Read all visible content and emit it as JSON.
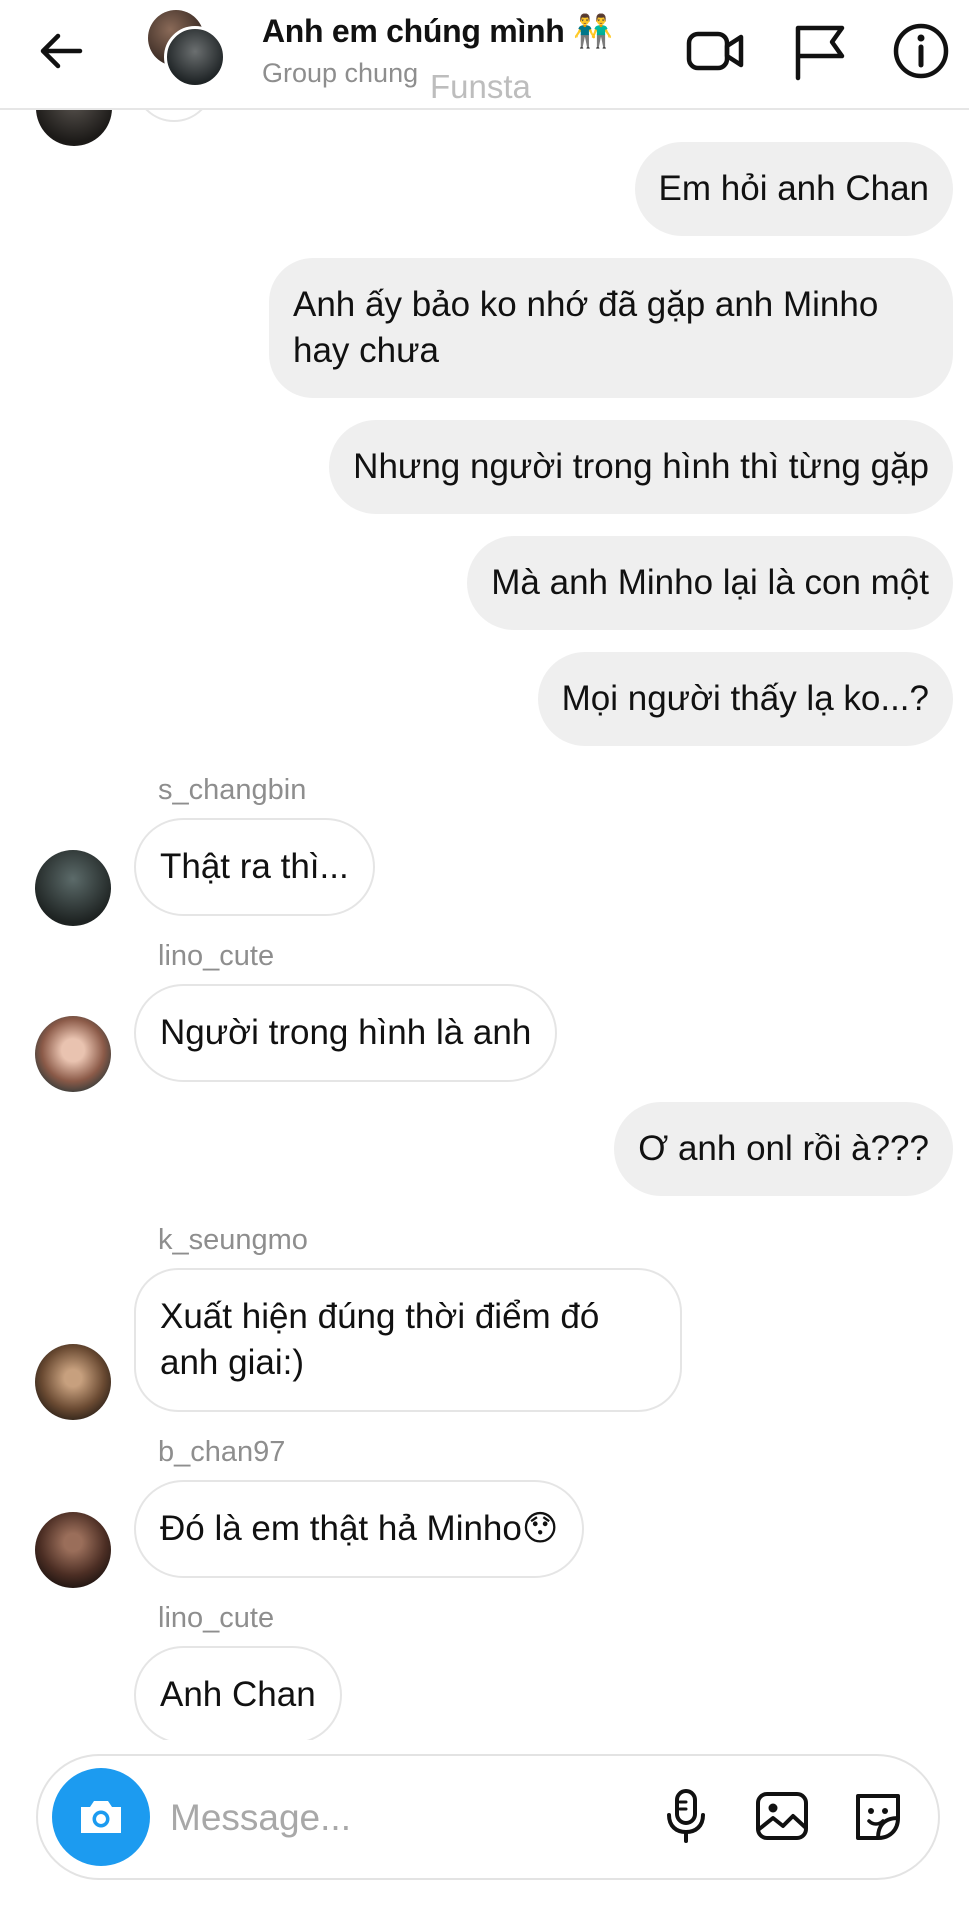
{
  "header": {
    "title": "Anh em chúng mình 👬",
    "subtitle": "Group chung",
    "overlay_text": "Funsta",
    "icons": [
      "back-arrow-icon",
      "video-call-icon",
      "flag-icon",
      "info-icon"
    ]
  },
  "messages": [
    {
      "side": "out",
      "text": "Em hỏi anh Chan"
    },
    {
      "side": "out",
      "text": "Anh ấy bảo ko nhớ đã gặp anh Minho hay chưa"
    },
    {
      "side": "out",
      "text": "Nhưng người trong hình thì từng gặp"
    },
    {
      "side": "out",
      "text": "Mà anh Minho lại là con một"
    },
    {
      "side": "out",
      "text": "Mọi người thấy lạ ko...?"
    },
    {
      "side": "in",
      "sender": "s_changbin",
      "text": "Thật ra thì..."
    },
    {
      "side": "in",
      "sender": "lino_cute",
      "text": "Người trong hình là anh"
    },
    {
      "side": "out",
      "text": "Ơ anh onl rồi à???"
    },
    {
      "side": "in",
      "sender": "k_seungmo",
      "text": "Xuất hiện đúng thời điểm đó anh giai:)"
    },
    {
      "side": "in",
      "sender": "b_chan97",
      "text": "Đó là em thật hả Minho😯"
    },
    {
      "side": "in",
      "sender": "lino_cute",
      "text": "Anh Chan"
    }
  ],
  "composer": {
    "placeholder": "Message...",
    "icons": [
      "camera-icon",
      "microphone-icon",
      "gallery-icon",
      "sticker-icon"
    ]
  },
  "colors": {
    "outgoing_bubble": "#efefef",
    "incoming_border": "#e5e5e5",
    "camera_button": "#1c9bf0",
    "secondary_text": "#8e8e8e"
  }
}
